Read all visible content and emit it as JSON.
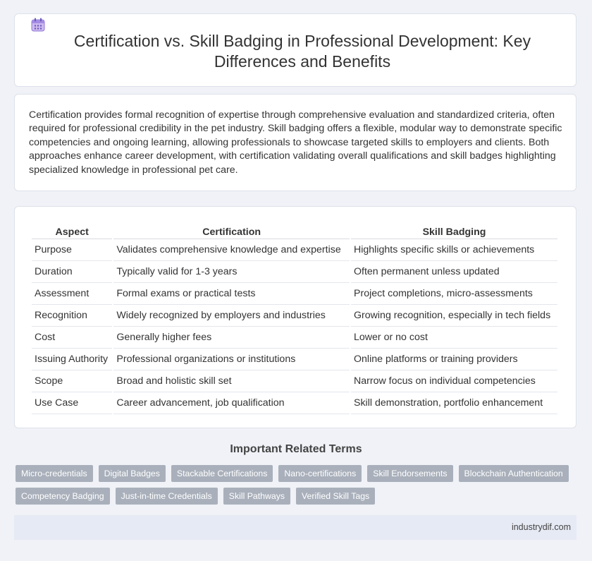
{
  "header": {
    "title": "Certification vs. Skill Badging in Professional Development: Key Differences and Benefits",
    "icon": "calendar-icon"
  },
  "intro": "Certification provides formal recognition of expertise through comprehensive evaluation and standardized criteria, often required for professional credibility in the pet industry. Skill badging offers a flexible, modular way to demonstrate specific competencies and ongoing learning, allowing professionals to showcase targeted skills to employers and clients. Both approaches enhance career development, with certification validating overall qualifications and skill badges highlighting specialized knowledge in professional pet care.",
  "table": {
    "headers": [
      "Aspect",
      "Certification",
      "Skill Badging"
    ],
    "rows": [
      [
        "Purpose",
        "Validates comprehensive knowledge and expertise",
        "Highlights specific skills or achievements"
      ],
      [
        "Duration",
        "Typically valid for 1-3 years",
        "Often permanent unless updated"
      ],
      [
        "Assessment",
        "Formal exams or practical tests",
        "Project completions, micro-assessments"
      ],
      [
        "Recognition",
        "Widely recognized by employers and industries",
        "Growing recognition, especially in tech fields"
      ],
      [
        "Cost",
        "Generally higher fees",
        "Lower or no cost"
      ],
      [
        "Issuing Authority",
        "Professional organizations or institutions",
        "Online platforms or training providers"
      ],
      [
        "Scope",
        "Broad and holistic skill set",
        "Narrow focus on individual competencies"
      ],
      [
        "Use Case",
        "Career advancement, job qualification",
        "Skill demonstration, portfolio enhancement"
      ]
    ]
  },
  "terms": {
    "title": "Important Related Terms",
    "items": [
      "Micro-credentials",
      "Digital Badges",
      "Stackable Certifications",
      "Nano-certifications",
      "Skill Endorsements",
      "Blockchain Authentication",
      "Competency Badging",
      "Just-in-time Credentials",
      "Skill Pathways",
      "Verified Skill Tags"
    ]
  },
  "footer": {
    "site": "industrydif.com"
  }
}
